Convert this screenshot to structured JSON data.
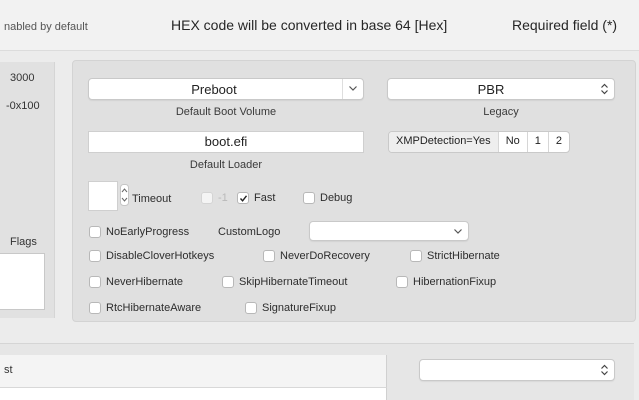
{
  "header": {
    "left_note": "nabled by default",
    "hex_note": "HEX code will be converted in base 64 [Hex]",
    "required_note": "Required field (*)"
  },
  "left_column": {
    "value_1": "3000",
    "value_2": "-0x100",
    "flags_label": "Flags"
  },
  "boot": {
    "default_boot_volume": {
      "value": "Preboot",
      "caption": "Default Boot Volume"
    },
    "legacy": {
      "value": "PBR",
      "caption": "Legacy"
    },
    "default_loader": {
      "value": "boot.efi",
      "caption": "Default Loader"
    },
    "xmp_segments": [
      "XMPDetection=Yes",
      "No",
      "1",
      "2"
    ],
    "timeout": {
      "value": "",
      "label": "Timeout"
    },
    "checkboxes_row1": [
      {
        "label": "-1",
        "checked": false,
        "disabled": true
      },
      {
        "label": "Fast",
        "checked": true,
        "disabled": false
      },
      {
        "label": "Debug",
        "checked": false,
        "disabled": false
      }
    ],
    "no_early_progress": {
      "label": "NoEarlyProgress",
      "checked": false
    },
    "custom_logo": {
      "label": "CustomLogo",
      "value": ""
    },
    "checkboxes_row3": [
      {
        "label": "DisableCloverHotkeys",
        "checked": false
      },
      {
        "label": "NeverDoRecovery",
        "checked": false
      },
      {
        "label": "StrictHibernate",
        "checked": false
      }
    ],
    "checkboxes_row4": [
      {
        "label": "NeverHibernate",
        "checked": false
      },
      {
        "label": "SkipHibernateTimeout",
        "checked": false
      },
      {
        "label": "HibernationFixup",
        "checked": false
      }
    ],
    "checkboxes_row5": [
      {
        "label": "RtcHibernateAware",
        "checked": false
      },
      {
        "label": "SignatureFixup",
        "checked": false
      }
    ]
  },
  "bottom": {
    "list_header": "st",
    "popup_value": ""
  },
  "icons": {
    "dropdown": "chevron-down-icon",
    "updown": "updown-chevron-icon",
    "check": "checkmark-icon"
  }
}
